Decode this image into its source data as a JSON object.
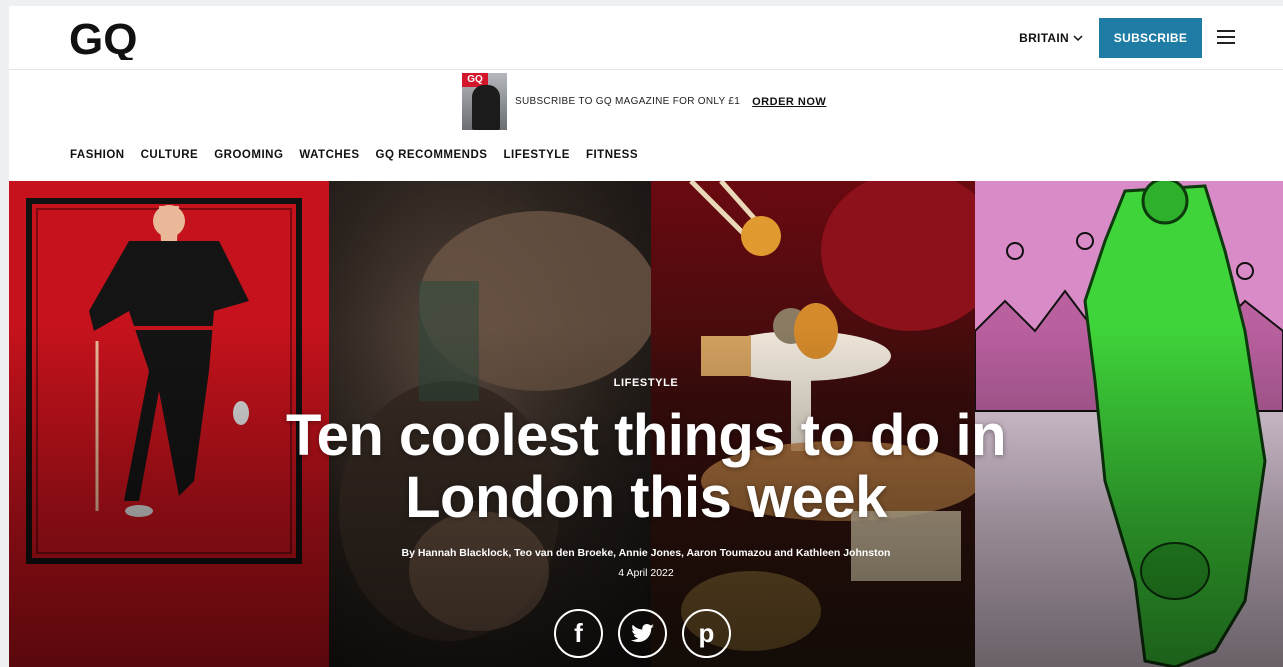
{
  "header": {
    "logo": "GQ",
    "region_label": "BRITAIN",
    "subscribe_label": "SUBSCRIBE",
    "brand_color": "#1f7da5"
  },
  "promo": {
    "cover_label": "GQ",
    "text": "SUBSCRIBE TO GQ MAGAZINE FOR ONLY £1",
    "cta_label": "ORDER NOW"
  },
  "nav": {
    "items": [
      "FASHION",
      "CULTURE",
      "GROOMING",
      "WATCHES",
      "GQ RECOMMENDS",
      "LIFESTYLE",
      "FITNESS"
    ]
  },
  "hero": {
    "kicker": "LIFESTYLE",
    "headline_line1": "Ten coolest things to do in",
    "headline_line2": "London this week",
    "byline": "By Hannah Blacklock, Teo van den Broeke, Annie Jones, Aaron Toumazou and Kathleen Johnston",
    "date": "4 April 2022",
    "share": [
      {
        "icon": "facebook-icon",
        "glyph": "f"
      },
      {
        "icon": "twitter-icon",
        "glyph": "t"
      },
      {
        "icon": "pinterest-icon",
        "glyph": "p"
      }
    ]
  }
}
